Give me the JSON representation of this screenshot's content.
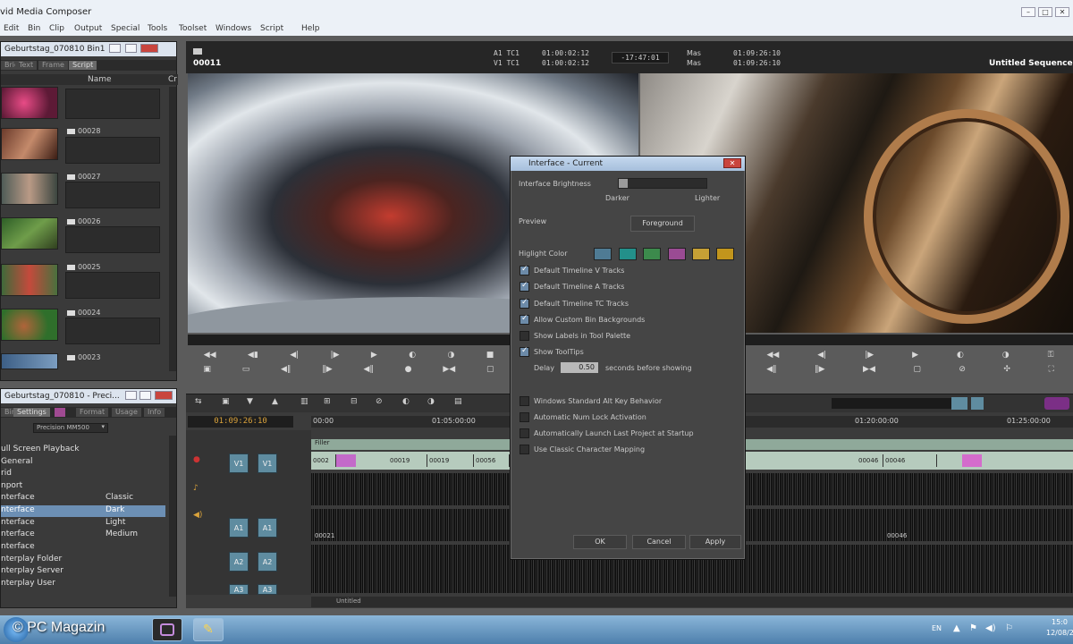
{
  "app": {
    "title": "vid Media Composer"
  },
  "menu": [
    "Edit",
    "Bin",
    "Clip",
    "Output",
    "Special",
    "Tools",
    "Toolset",
    "Windows",
    "Script",
    "Help"
  ],
  "bin": {
    "title": "Geburtstag_070810 Bin1",
    "tabs": [
      "Brief",
      "Text",
      "Frame",
      "Script"
    ],
    "col_name": "Name",
    "col_extra": "Cr",
    "clips": [
      "00028",
      "00027",
      "00026",
      "00025",
      "00024",
      "00023"
    ]
  },
  "settings": {
    "title": "Geburtstag_070810 - Preci...",
    "tabs": [
      "Bins",
      "Settings",
      "Format",
      "Usage",
      "Info"
    ],
    "project_label": "Precision MM500",
    "rows": [
      {
        "name": "ull Screen Playback",
        "value": ""
      },
      {
        "name": "General",
        "value": ""
      },
      {
        "name": "rid",
        "value": ""
      },
      {
        "name": "nport",
        "value": ""
      },
      {
        "name": "nterface",
        "value": "Classic"
      },
      {
        "name": "nterface",
        "value": "Dark"
      },
      {
        "name": "nterface",
        "value": "Light"
      },
      {
        "name": "nterface",
        "value": "Medium"
      },
      {
        "name": "nterface",
        "value": ""
      },
      {
        "name": "nterplay Folder",
        "value": ""
      },
      {
        "name": "nterplay Server",
        "value": ""
      },
      {
        "name": "nterplay User",
        "value": ""
      }
    ],
    "selected": 5
  },
  "composer": {
    "clip_name": "00011",
    "seq_name": "Untitled Sequence.01",
    "tc_a1_label": "A1 TC1",
    "tc_a1": "01:00:02:12",
    "tc_v1_label": "V1 TC1",
    "tc_v1": "01:00:02:12",
    "tc_offset": "-17:47:01",
    "mas1_label": "Mas",
    "mas1": "01:09:26:10",
    "mas2_label": "Mas",
    "mas2": "01:09:26:10"
  },
  "timeline": {
    "timecode": "01:09:26:10",
    "ruler": [
      "00:00",
      "01:05:00:00",
      "01:20:00:00",
      "01:25:00:00"
    ],
    "filler": "Filler",
    "tracks": [
      "V1",
      "A1",
      "A2",
      "A3"
    ],
    "record_tracks": [
      "V1",
      "A1",
      "A2",
      "A3"
    ],
    "clips_v1": [
      "0002",
      "00019",
      "00019",
      "00056"
    ],
    "clips_v1_right": [
      "00046",
      "00046"
    ],
    "clips_a2": [
      "00021",
      "00046"
    ],
    "bottom_label": "Untitled"
  },
  "dialog": {
    "title": "Interface - Current",
    "close": "✕",
    "brightness_label": "Interface Brightness",
    "darker": "Darker",
    "lighter": "Lighter",
    "preview_label": "Preview",
    "foreground_button": "Foreground",
    "highlight_label": "Higlight Color",
    "swatches": [
      "#4f7b94",
      "#23908a",
      "#3c8a4c",
      "#9a4b93",
      "#c6a035",
      "#c2951c"
    ],
    "options": [
      {
        "label": "Default Timeline V Tracks",
        "checked": true
      },
      {
        "label": "Default Timeline A Tracks",
        "checked": true
      },
      {
        "label": "Default Timeline TC Tracks",
        "checked": true
      },
      {
        "label": "Allow Custom Bin Backgrounds",
        "checked": true
      },
      {
        "label": "Show Labels in Tool Palette",
        "checked": false
      },
      {
        "label": "Show ToolTips",
        "checked": true
      }
    ],
    "delay_label": "Delay",
    "delay_value": "0.50",
    "delay_suffix": "seconds before showing",
    "options2": [
      {
        "label": "Windows Standard Alt Key Behavior",
        "checked": false
      },
      {
        "label": "Automatic Num Lock Activation",
        "checked": false
      },
      {
        "label": "Automatically Launch Last Project at Startup",
        "checked": false
      },
      {
        "label": "Use Classic Character Mapping",
        "checked": false
      }
    ],
    "ok": "OK",
    "cancel": "Cancel",
    "apply": "Apply"
  },
  "taskbar": {
    "watermark": "© PC Magazin",
    "lang": "EN",
    "time": "15:0",
    "date": "12/08/2"
  }
}
